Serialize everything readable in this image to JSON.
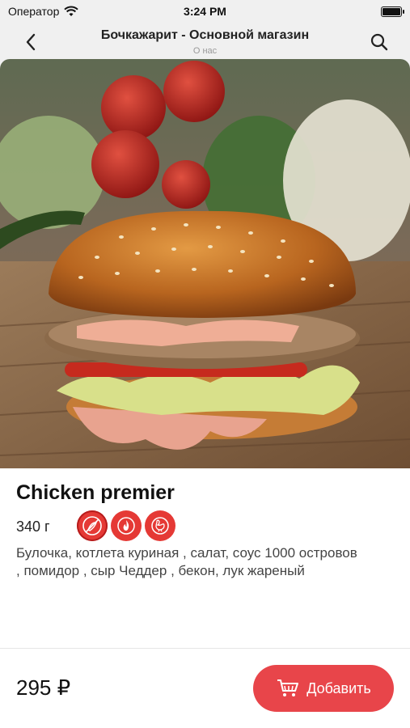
{
  "status": {
    "carrier": "Оператор",
    "time": "3:24 PM"
  },
  "nav": {
    "title": "Бочкажарит - Основной магазин",
    "subtitle": "О нас"
  },
  "product": {
    "name": "Chicken premier",
    "weight": "340 г",
    "description": "Булочка, котлета куриная , салат, соус 1000 островов , помидор , сыр Чеддер , бекон, лук жареный",
    "price": "295 ₽"
  },
  "badges": [
    "no-spicy-icon",
    "fire-icon",
    "chicken-icon"
  ],
  "actions": {
    "add_label": "Добавить"
  },
  "colors": {
    "accent": "#e8454a",
    "badge": "#e53935"
  }
}
